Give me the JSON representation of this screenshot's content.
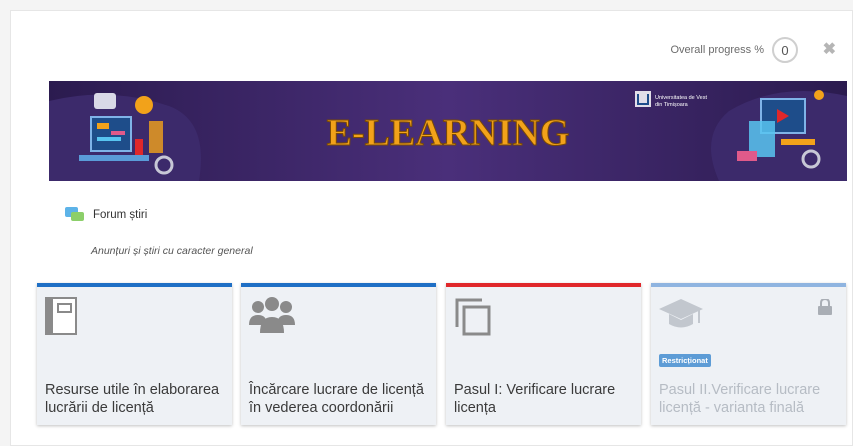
{
  "header": {
    "progress_label": "Overall progress %",
    "progress_value": "0",
    "close_symbol": "✖"
  },
  "banner": {
    "title": "E-LEARNING",
    "university": "Universitatea de Vest din Timișoara",
    "bg_left": "#2b1b4f",
    "bg_mid": "#4a2f7a",
    "title_color": "#f2a21a"
  },
  "forum": {
    "label": "Forum știri",
    "description": "Anunțuri și știri cu caracter general"
  },
  "tiles": [
    {
      "title": "Resurse utile în elaborarea lucrării de licență",
      "bar_color": "#1f6fc5",
      "icon": "notebook-icon",
      "restricted": false
    },
    {
      "title": "Încărcare lucrare de licență în vederea coordonării",
      "bar_color": "#1f6fc5",
      "icon": "group-icon",
      "restricted": false
    },
    {
      "title": "Pasul I: Verificare lucrare licența",
      "bar_color": "#e0272a",
      "icon": "copy-icon",
      "restricted": false
    },
    {
      "title": "Pasul II.Verificare lucrare licență - varianta finală",
      "bar_color": "#8fb4e0",
      "icon": "graduation-cap-icon",
      "restricted": true,
      "badge": "Restricționat"
    }
  ]
}
